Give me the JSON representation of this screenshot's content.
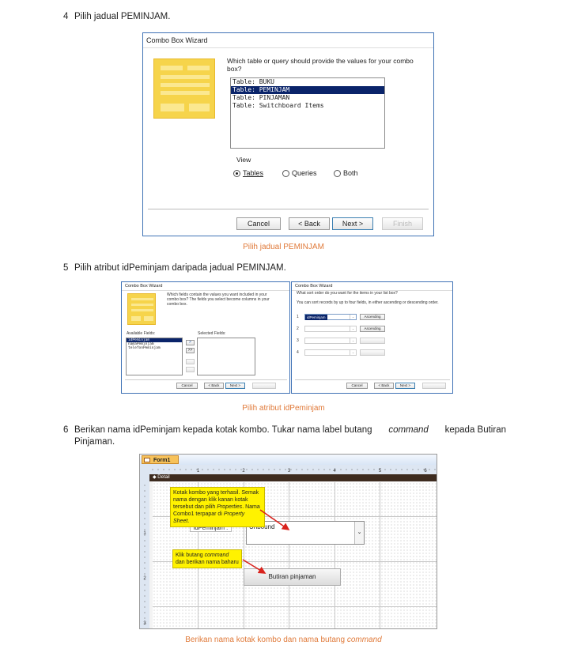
{
  "step4": {
    "num": "4",
    "text": "Pilih jadual PEMINJAM."
  },
  "wizard1": {
    "title": "Combo Box Wizard",
    "question": "Which table or query should provide the values for your combo box?",
    "items": [
      "Table: BUKU",
      "Table: PEMINJAM",
      "Table: PINJAMAN",
      "Table: Switchboard Items"
    ],
    "selected_index": 1,
    "view_label": "View",
    "radio_tables": "Tables",
    "radio_queries": "Queries",
    "radio_both": "Both",
    "cancel": "Cancel",
    "back": "< Back",
    "next": "Next >",
    "finish": "Finish"
  },
  "caption1": "Pilih jadual PEMINJAM",
  "step5": {
    "num": "5",
    "text": "Pilih atribut idPeminjam daripada jadual PEMINJAM."
  },
  "wizard2": {
    "title": "Combo Box Wizard",
    "question": "Which fields contain the values you want included in your combo box? The fields you select become columns in your combo box.",
    "available_label": "Available Fields:",
    "selected_label": "Selected Fields:",
    "fields": [
      "idPeminjam",
      "namaPeminjam",
      "telefonPeminjam"
    ],
    "btn_one": ">",
    "btn_all": ">>",
    "cancel": "Cancel",
    "back": "< Back",
    "next": "Next >"
  },
  "wizard3": {
    "title": "Combo Box Wizard",
    "question": "What sort order do you want for the items in your list box?",
    "hint": "You can sort records by up to four fields, in either ascending or descending order.",
    "rows": [
      {
        "n": "1",
        "value": "idPeminjam",
        "order": "Ascending"
      },
      {
        "n": "2",
        "value": "",
        "order": "Ascending"
      },
      {
        "n": "3",
        "value": "",
        "order": ""
      },
      {
        "n": "4",
        "value": "",
        "order": ""
      }
    ],
    "cancel": "Cancel",
    "back": "< Back",
    "next": "Next >"
  },
  "caption2": "Pilih atribut idPeminjam",
  "step6": {
    "num": "6",
    "line1": "Berikan nama idPeminjam kepada kotak kombo. Tukar nama label butang",
    "em": "command",
    "line1_end": "kepada Butiran",
    "line2": "Pinjaman."
  },
  "form": {
    "tab": "Form1",
    "detail": "Detail",
    "ruler_marks": [
      "1",
      "2",
      "3",
      "4",
      "5",
      "6"
    ],
    "side_marks": [
      "1",
      "2",
      "3"
    ],
    "label": "idPeminjam :",
    "combo_value": "Unbound",
    "button_label": "Butiran pinjaman",
    "note1_a": "Kotak kombo yang terhasil. Semak nama dengan klik kanan kotak tersebut dan pilih",
    "note1_em1": "Properties",
    "note1_b": ". Nama Combo1 terpapar di",
    "note1_em2": "Property Sheet",
    "note1_c": ".",
    "note2_a": "Klik butang",
    "note2_em": "command",
    "note2_b": "dan berikan nama baharu"
  },
  "caption3_a": "Berikan nama kotak kombo dan nama butang",
  "caption3_em": "command",
  "colors": {
    "caption": "#e07a3a",
    "note": "#fff200",
    "arrow": "#d9221c",
    "selection": "#0a246a",
    "access_header": "#e8862d",
    "detail_bar": "#3d2b1f"
  }
}
